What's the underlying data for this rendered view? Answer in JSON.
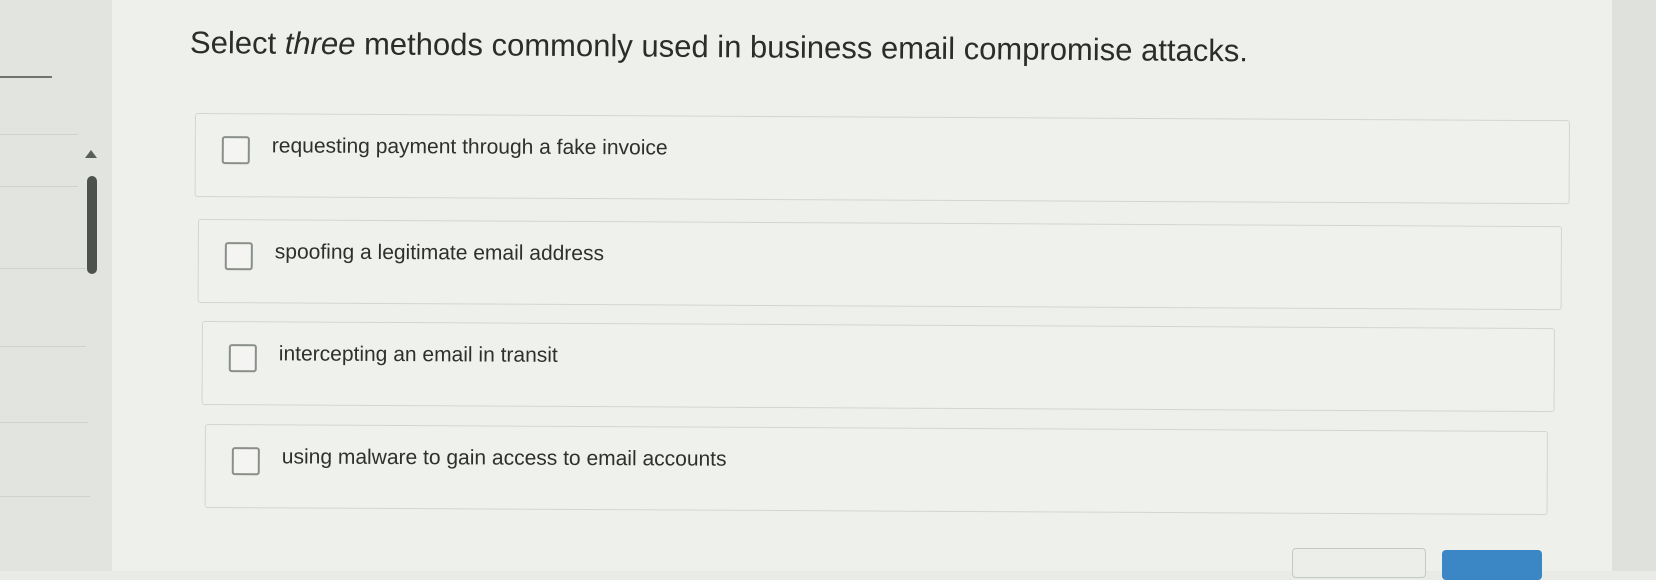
{
  "question": {
    "prefix": "Select ",
    "emphasis": "three",
    "suffix": " methods commonly used in business email compromise attacks."
  },
  "options": [
    {
      "label": "requesting payment through a fake invoice",
      "checked": false
    },
    {
      "label": "spoofing a legitimate email address",
      "checked": false
    },
    {
      "label": "intercepting an email in transit",
      "checked": false
    },
    {
      "label": "using malware to gain access to email accounts",
      "checked": false
    }
  ],
  "buttons": {
    "previous_label": "",
    "next_label": ""
  },
  "colors": {
    "next_button": "#3b87c6",
    "background": "#eef0ec"
  }
}
